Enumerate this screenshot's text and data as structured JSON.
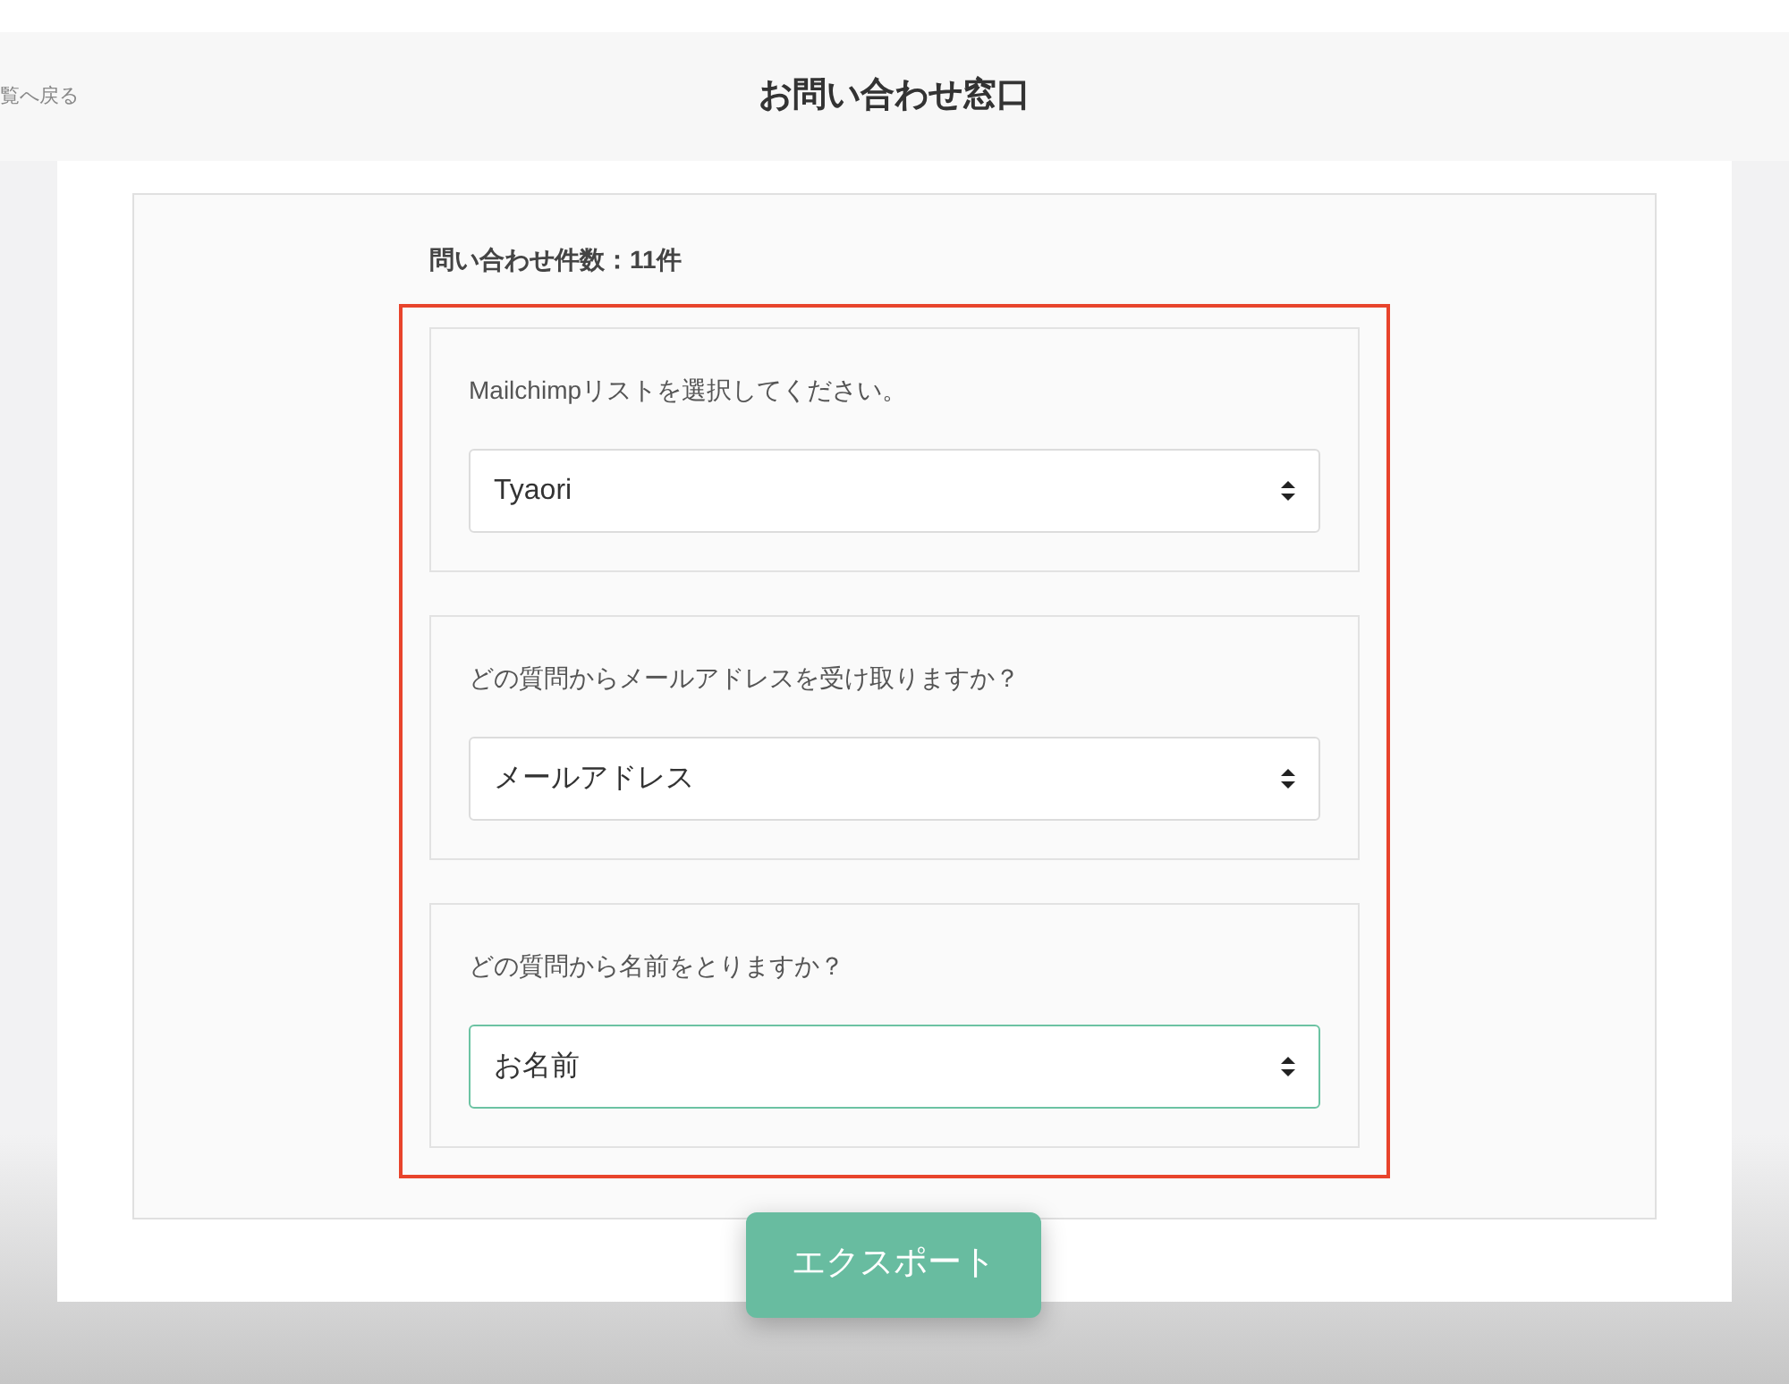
{
  "header": {
    "back_link": "覧へ戻る",
    "title": "お問い合わせ窓口"
  },
  "count_label": "問い合わせ件数：11件",
  "sections": [
    {
      "question": "Mailchimpリストを選択してください。",
      "value": "Tyaori",
      "focused": false
    },
    {
      "question": "どの質問からメールアドレスを受け取りますか？",
      "value": "メールアドレス",
      "focused": false
    },
    {
      "question": "どの質問から名前をとりますか？",
      "value": "お名前",
      "focused": true
    }
  ],
  "export_button": "エクスポート"
}
